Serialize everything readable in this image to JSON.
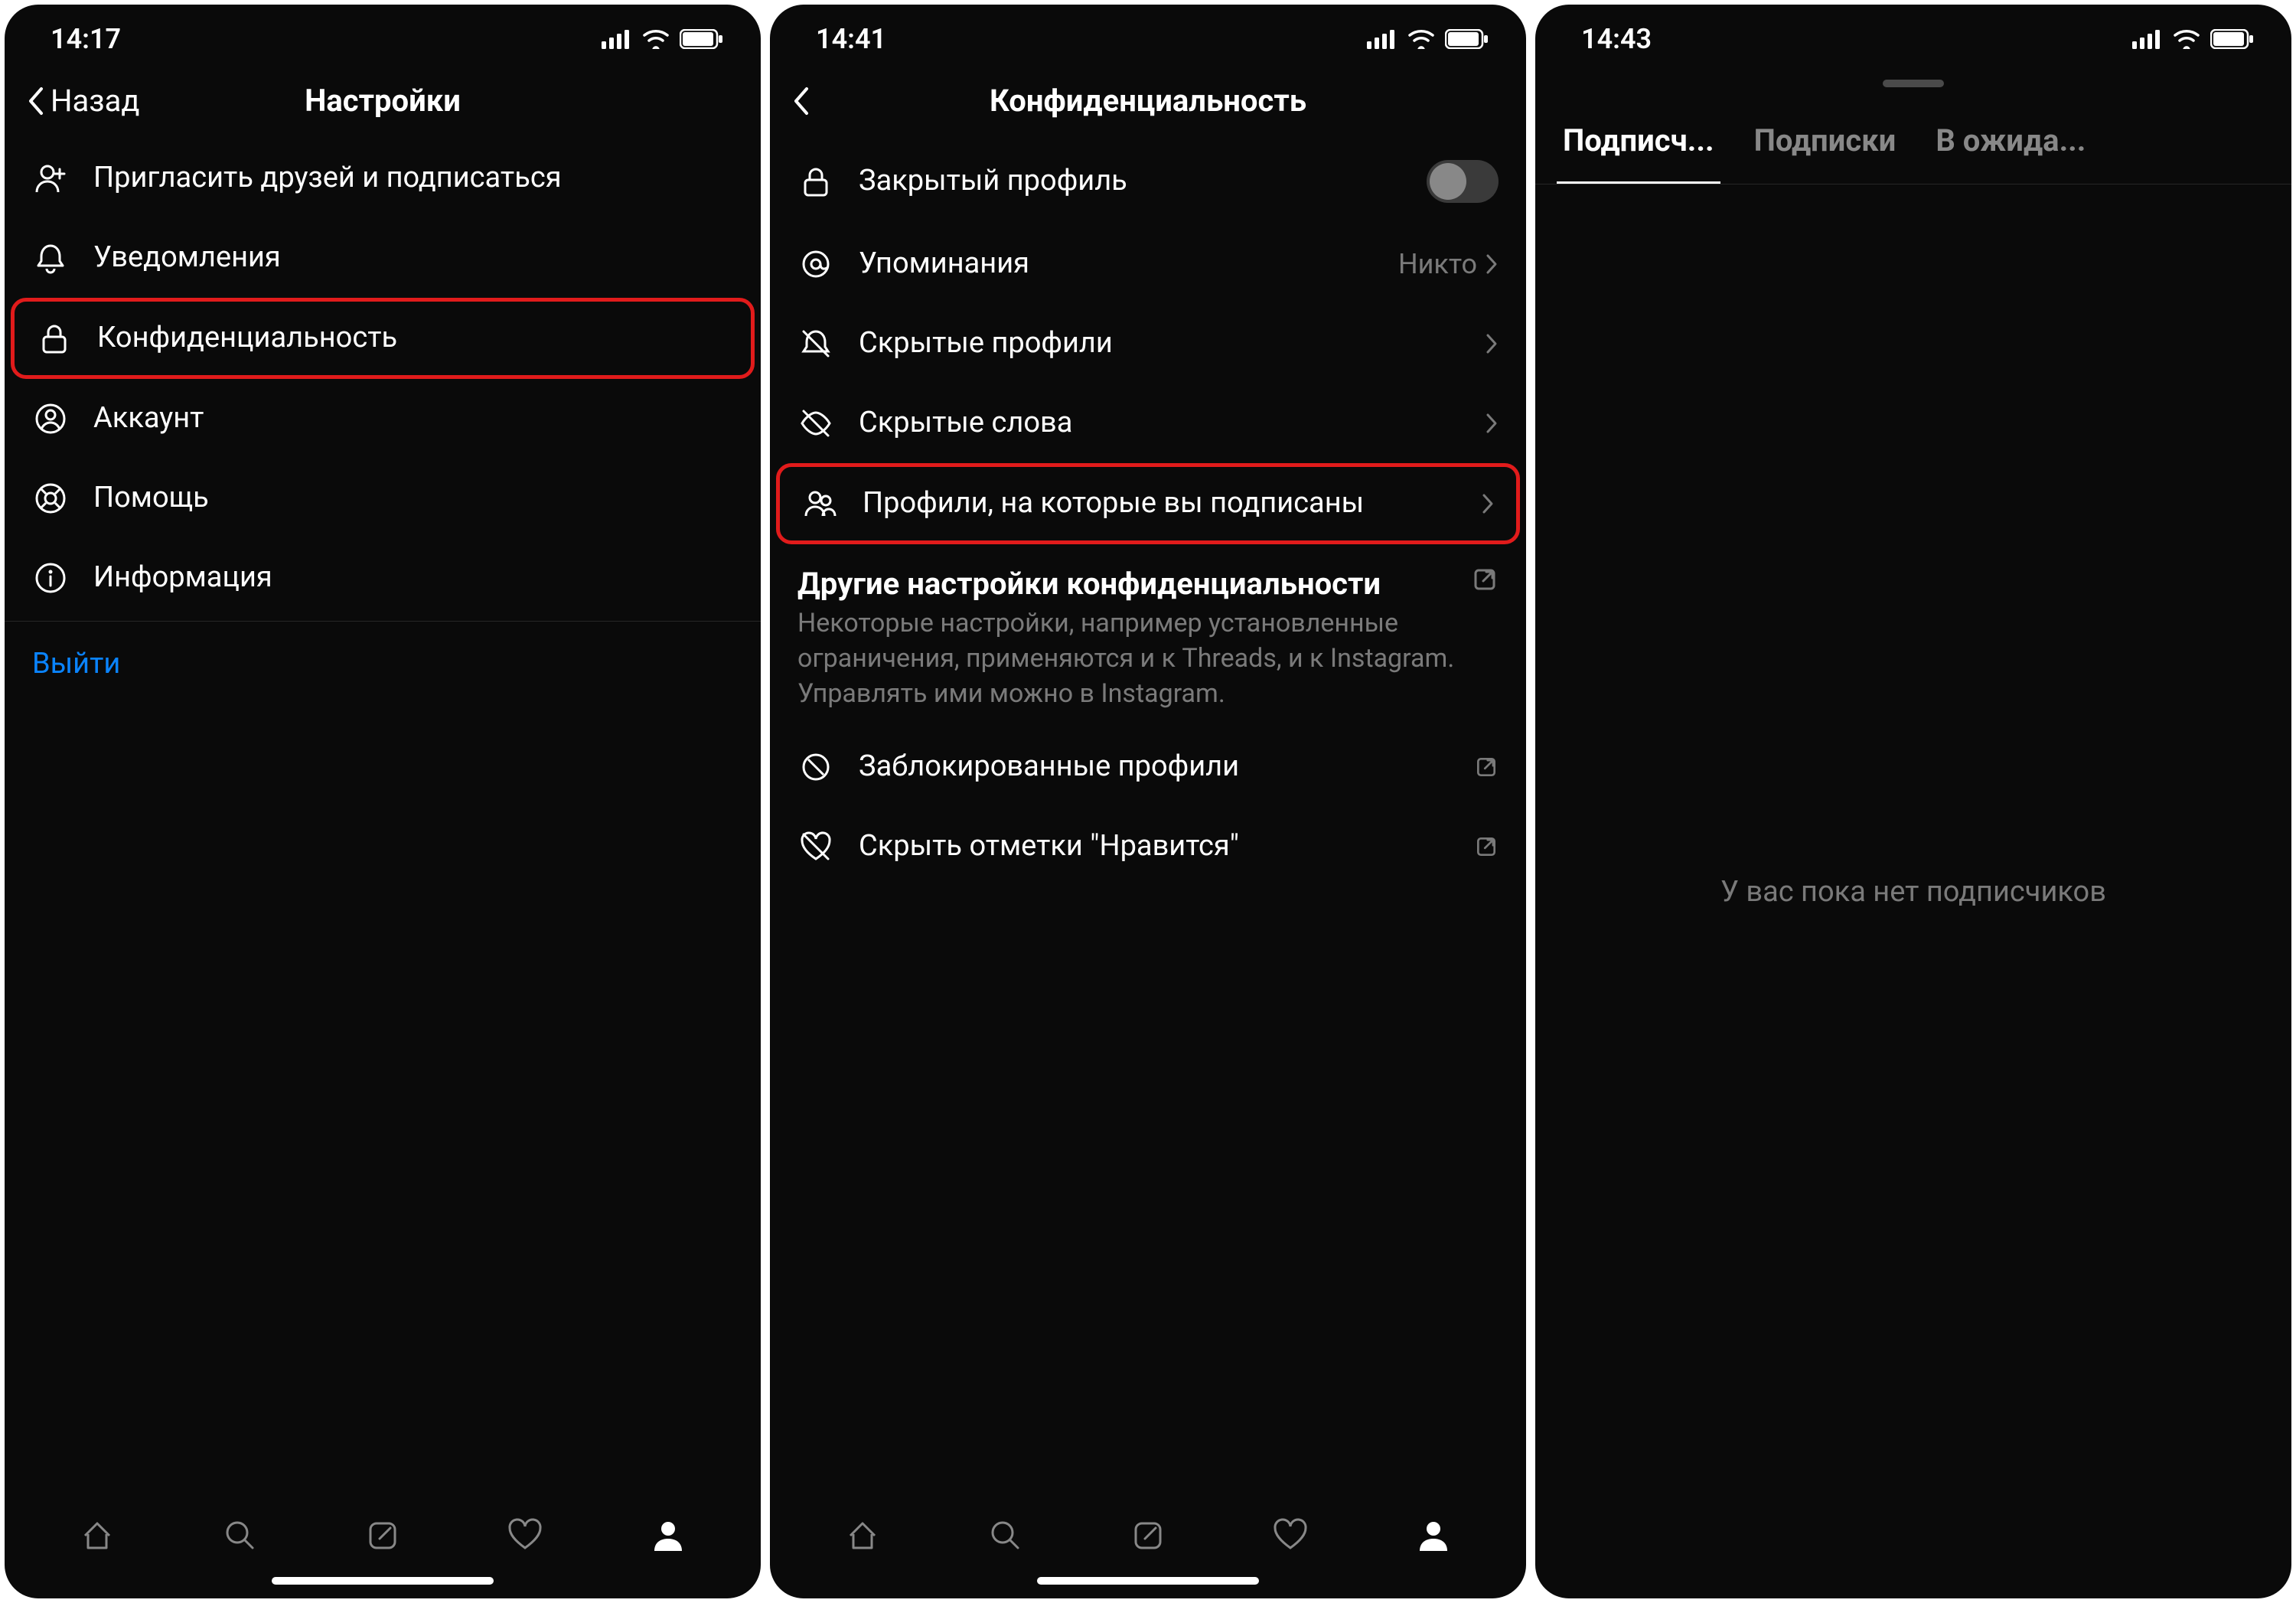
{
  "screen1": {
    "time": "14:17",
    "back_label": "Назад",
    "title": "Настройки",
    "items": {
      "invite": "Пригласить друзей и подписаться",
      "notifications": "Уведомления",
      "privacy": "Конфиденциальность",
      "account": "Аккаунт",
      "help": "Помощь",
      "info": "Информация"
    },
    "logout": "Выйти"
  },
  "screen2": {
    "time": "14:41",
    "title": "Конфиденциальность",
    "rows": {
      "private": "Закрытый профиль",
      "mentions": "Упоминания",
      "mentions_value": "Никто",
      "hidden_profiles": "Скрытые профили",
      "hidden_words": "Скрытые слова",
      "following": "Профили, на которые вы подписаны"
    },
    "other_title": "Другие настройки конфиденциальности",
    "other_desc": "Некоторые настройки, например установленные ограничения, применяются и к Threads, и к Instagram. Управлять ими можно в Instagram.",
    "blocked": "Заблокированные профили",
    "hide_likes": "Скрыть отметки \"Нравится\""
  },
  "screen3": {
    "time": "14:43",
    "tabs": {
      "followers": "Подписч...",
      "following": "Подписки",
      "pending": "В ожида..."
    },
    "empty": "У вас пока нет подписчиков"
  }
}
